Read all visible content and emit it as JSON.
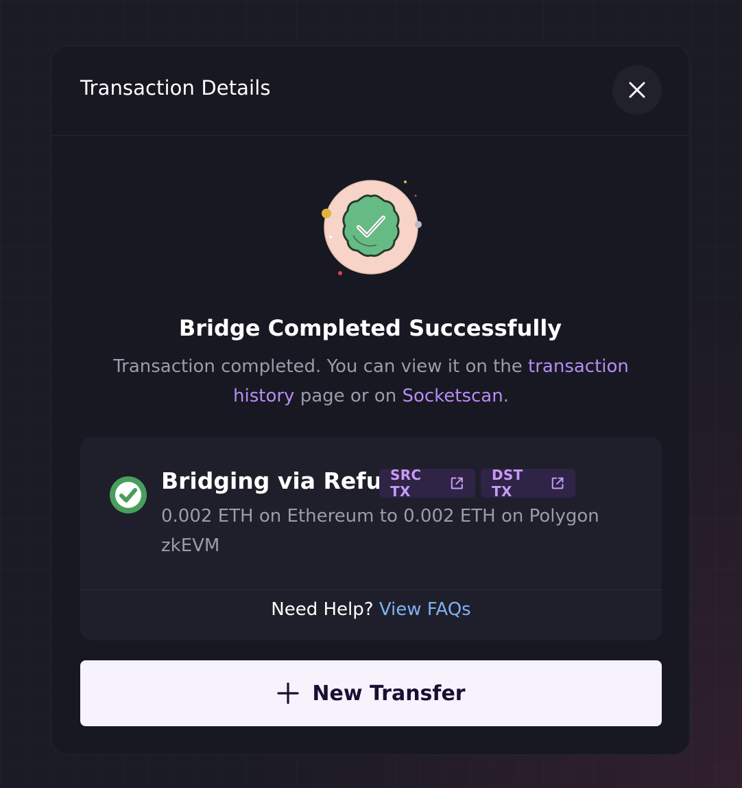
{
  "modal": {
    "title": "Transaction Details",
    "close_icon": "close-icon"
  },
  "status": {
    "icon": "success-badge-icon",
    "headline": "Bridge Completed Successfully",
    "description_prefix": "Transaction completed. You can view it on the ",
    "history_link": "transaction history",
    "description_middle": " page or on ",
    "socketscan_link": "Socketscan",
    "description_suffix": "."
  },
  "route": {
    "status_icon": "check-circle-icon",
    "title": "Bridging via Refuel",
    "src_tx_label": "SRC TX",
    "dst_tx_label": "DST TX",
    "link_icon": "external-link-icon",
    "summary": "0.002 ETH on Ethereum to 0.002 ETH on Polygon zkEVM"
  },
  "help": {
    "prompt": "Need Help? ",
    "link": "View FAQs"
  },
  "actions": {
    "new_transfer_icon": "plus-icon",
    "new_transfer_label": "New Transfer"
  },
  "colors": {
    "accent_purple": "#b78cf4",
    "link_blue": "#7fb2f2",
    "success_green": "#4a9e5c",
    "badge_bg": "#f8d3c8"
  }
}
